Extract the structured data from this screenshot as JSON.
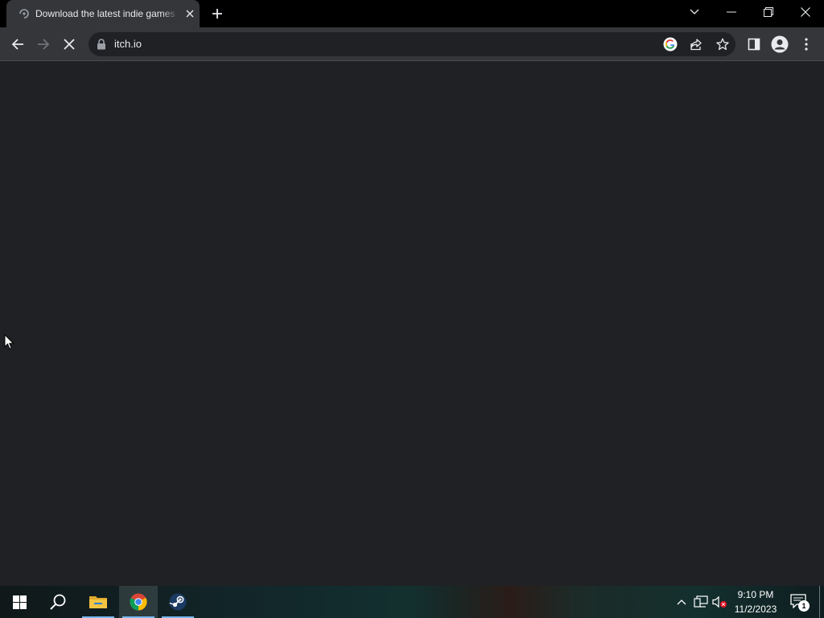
{
  "colors": {
    "tab_strip": "#000000",
    "active_tab": "#35363a",
    "toolbar": "#35363a",
    "omnibox": "#202124",
    "page_background": "#202124",
    "text": "#e8eaed",
    "taskbar_accent": "#76b9ed"
  },
  "tab": {
    "title": "Download the latest indie games",
    "favicon": "loading-favicon-icon",
    "close_icon": "close-icon"
  },
  "window_controls": {
    "tab_search_icon": "chevron-down-icon",
    "minimize_icon": "minimize-icon",
    "restore_icon": "restore-icon",
    "close_icon": "close-icon"
  },
  "toolbar": {
    "back_icon": "arrow-left-icon",
    "forward_icon": "arrow-right-icon",
    "stop_icon": "stop-loading-icon",
    "url": "itch.io",
    "google_lens_icon": "google-icon",
    "share_icon": "share-icon",
    "bookmark_icon": "star-icon",
    "side_panel_icon": "side-panel-icon",
    "profile_icon": "profile-icon",
    "menu_icon": "kebab-menu-icon"
  },
  "taskbar": {
    "apps": [
      {
        "name": "Start",
        "icon": "windows-start-icon"
      },
      {
        "name": "Search",
        "icon": "search-icon"
      },
      {
        "name": "File Explorer",
        "icon": "folder-icon"
      },
      {
        "name": "Google Chrome",
        "icon": "chrome-icon"
      },
      {
        "name": "Steam",
        "icon": "steam-icon"
      }
    ],
    "tray": {
      "chevron_icon": "chevron-up-icon",
      "network_icon": "network-icon",
      "volume_icon": "volume-muted-icon"
    },
    "clock": {
      "time": "9:10 PM",
      "date": "11/2/2023"
    },
    "notifications": {
      "icon": "notification-icon",
      "count": "1"
    }
  }
}
